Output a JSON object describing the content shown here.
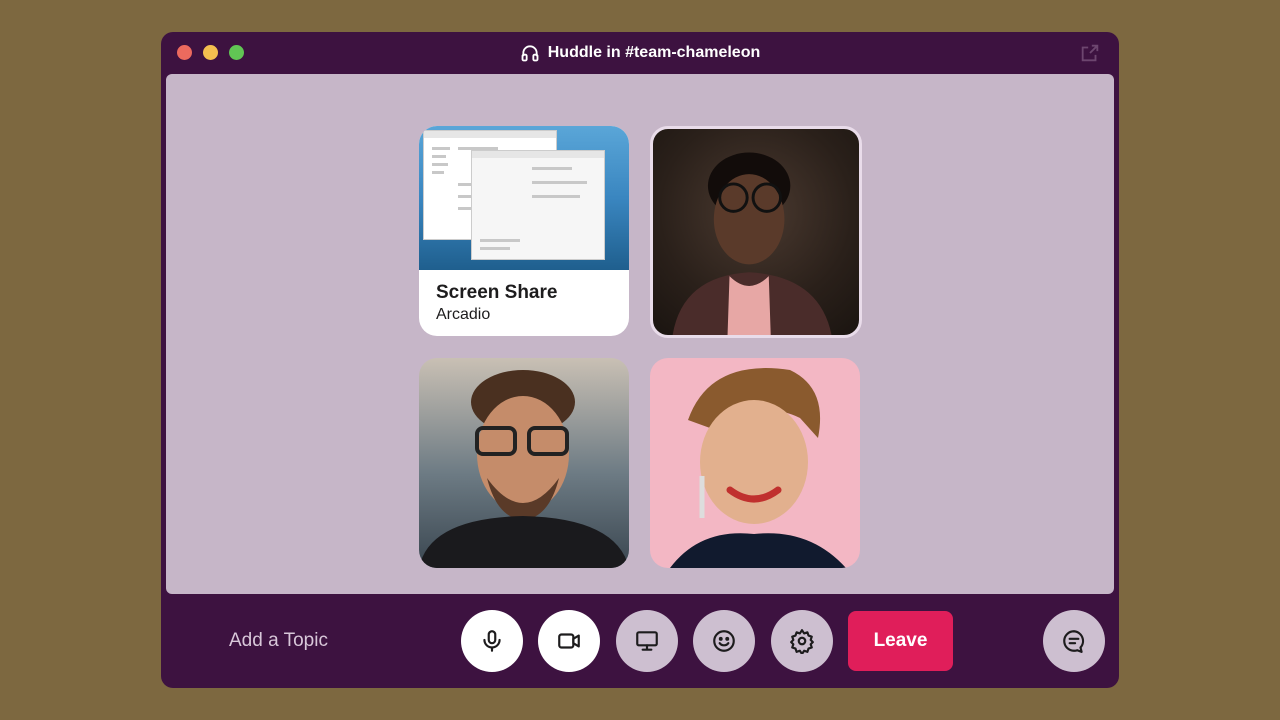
{
  "window": {
    "title": "Huddle in #team-chameleon",
    "title_icon": "headphones-icon"
  },
  "tiles": {
    "screen_share": {
      "title": "Screen Share",
      "presenter": "Arcadio"
    }
  },
  "controls": {
    "topic_placeholder": "Add a Topic",
    "leave_label": "Leave",
    "buttons": [
      "microphone-icon",
      "video-camera-icon",
      "screen-share-icon",
      "emoji-icon",
      "settings-gear-icon"
    ],
    "thread_button": "thread-chat-icon"
  },
  "colors": {
    "window_bg": "#3d1240",
    "stage_bg": "#c6b6c8",
    "leave": "#e01e5a",
    "outer_bg": "#7d6840"
  }
}
